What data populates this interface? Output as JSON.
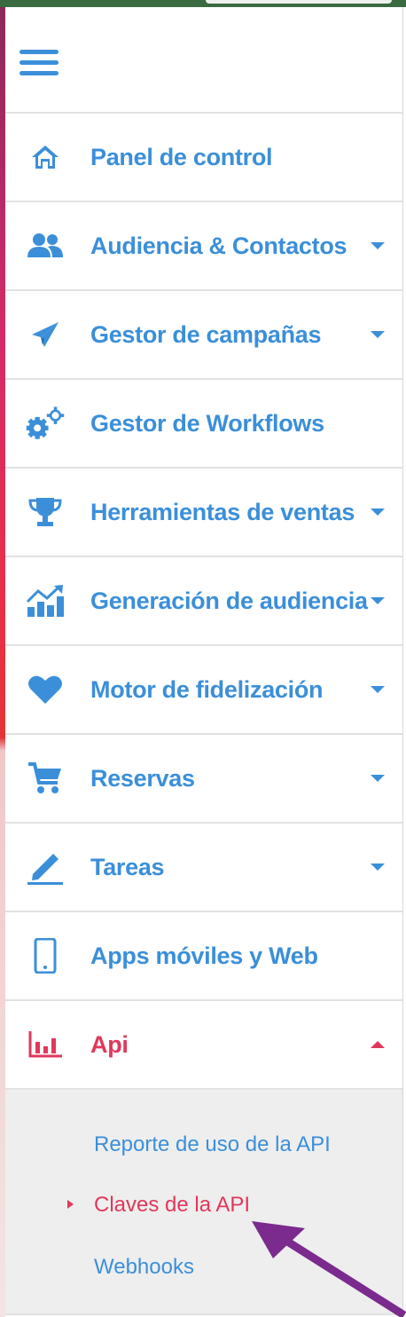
{
  "menu": {
    "items": [
      {
        "label": "Panel de control",
        "icon": "home-icon",
        "has_submenu": false
      },
      {
        "label": "Audiencia & Contactos",
        "icon": "users-icon",
        "has_submenu": true
      },
      {
        "label": "Gestor de campañas",
        "icon": "paper-plane-icon",
        "has_submenu": true
      },
      {
        "label": "Gestor de Workflows",
        "icon": "gears-icon",
        "has_submenu": false
      },
      {
        "label": "Herramientas de ventas",
        "icon": "trophy-icon",
        "has_submenu": true
      },
      {
        "label": "Generación de audiencia",
        "icon": "growth-chart-icon",
        "has_submenu": true
      },
      {
        "label": "Motor de fidelización",
        "icon": "heart-icon",
        "has_submenu": true
      },
      {
        "label": "Reservas",
        "icon": "cart-icon",
        "has_submenu": true
      },
      {
        "label": "Tareas",
        "icon": "pencil-icon",
        "has_submenu": true
      },
      {
        "label": "Apps móviles y Web",
        "icon": "mobile-icon",
        "has_submenu": false
      },
      {
        "label": "Api",
        "icon": "bar-chart-icon",
        "has_submenu": true,
        "expanded": true
      }
    ],
    "api_submenu": [
      {
        "label": "Reporte de uso de la API",
        "active": false
      },
      {
        "label": "Claves de la API",
        "active": true
      },
      {
        "label": "Webhooks",
        "active": false
      }
    ]
  },
  "colors": {
    "primary": "#3b8fd9",
    "active": "#e0385a",
    "annotation_arrow": "#7b2a8e"
  }
}
